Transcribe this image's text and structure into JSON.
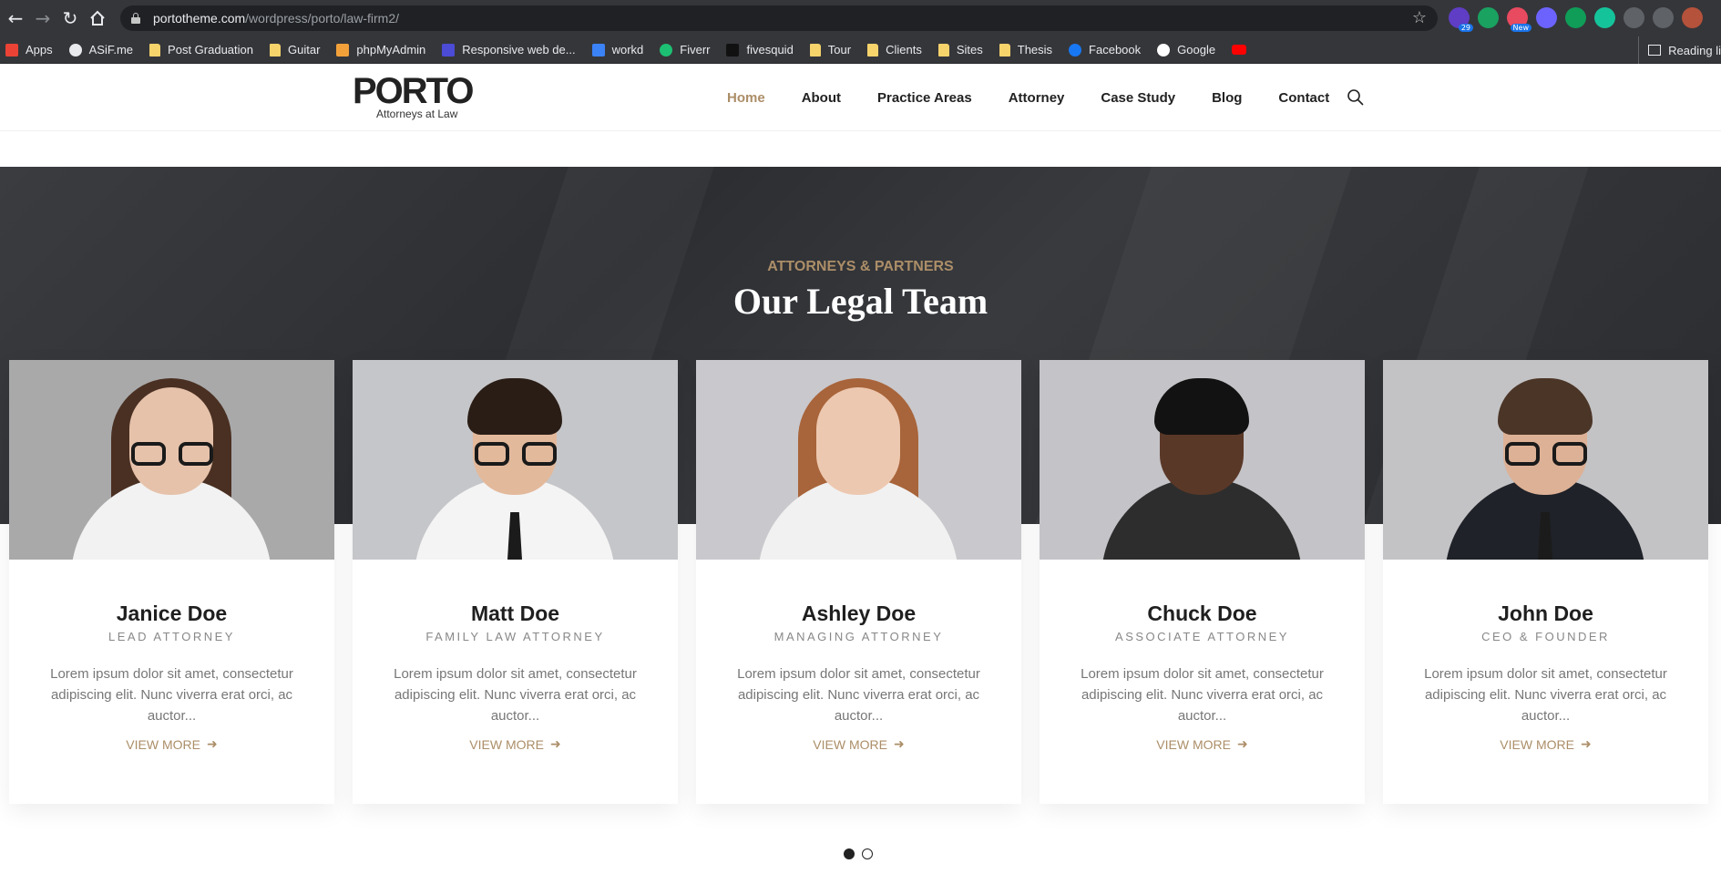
{
  "browser": {
    "url_host": "portotheme.com",
    "url_path": "/wordpress/porto/law-firm2/",
    "extensions": [
      {
        "name": "ext-29",
        "badge": "29",
        "color": "#5f3dc4"
      },
      {
        "name": "ext-refresh",
        "badge": "",
        "color": "#1aa260"
      },
      {
        "name": "ext-rainbow",
        "badge": "New",
        "color": "#e84a5f"
      },
      {
        "name": "ext-pen",
        "badge": "",
        "color": "#6c63ff"
      },
      {
        "name": "ext-leaf",
        "badge": "",
        "color": "#0f9d58"
      },
      {
        "name": "ext-grammarly",
        "badge": "",
        "color": "#15c39a"
      },
      {
        "name": "puzzle-icon",
        "badge": "",
        "color": "#5f6368"
      },
      {
        "name": "media-icon",
        "badge": "",
        "color": "#5f6368"
      },
      {
        "name": "profile-avatar",
        "badge": "",
        "color": "#b5523b"
      }
    ]
  },
  "bookmarks": [
    {
      "label": "Apps",
      "icon": "apps-grid",
      "color": "#ea4335"
    },
    {
      "label": "ASiF.me",
      "icon": "globe",
      "color": "#e8eaed"
    },
    {
      "label": "Post Graduation",
      "icon": "folder",
      "color": "#f6d36b"
    },
    {
      "label": "Guitar",
      "icon": "folder",
      "color": "#f6d36b"
    },
    {
      "label": "phpMyAdmin",
      "icon": "phpmyadmin",
      "color": "#f2a13a"
    },
    {
      "label": "Responsive web de...",
      "icon": "w-logo",
      "color": "#4b4bd6"
    },
    {
      "label": "workd",
      "icon": "check-logo",
      "color": "#3b82f6"
    },
    {
      "label": "Fiverr",
      "icon": "fiverr",
      "color": "#1dbf73"
    },
    {
      "label": "fivesquid",
      "icon": "f-logo",
      "color": "#111111"
    },
    {
      "label": "Tour",
      "icon": "folder",
      "color": "#f6d36b"
    },
    {
      "label": "Clients",
      "icon": "folder",
      "color": "#f6d36b"
    },
    {
      "label": "Sites",
      "icon": "folder",
      "color": "#f6d36b"
    },
    {
      "label": "Thesis",
      "icon": "folder",
      "color": "#f6d36b"
    },
    {
      "label": "Facebook",
      "icon": "facebook",
      "color": "#1877f2"
    },
    {
      "label": "Google",
      "icon": "google",
      "color": "#ffffff"
    },
    {
      "label": "",
      "icon": "youtube",
      "color": "#ff0000"
    }
  ],
  "reading_list_label": "Reading li",
  "site": {
    "logo": "PORTO",
    "tagline": "Attorneys at Law",
    "nav": [
      {
        "label": "Home",
        "active": true
      },
      {
        "label": "About",
        "active": false
      },
      {
        "label": "Practice Areas",
        "active": false
      },
      {
        "label": "Attorney",
        "active": false
      },
      {
        "label": "Case Study",
        "active": false
      },
      {
        "label": "Blog",
        "active": false
      },
      {
        "label": "Contact",
        "active": false
      }
    ],
    "accent_color": "#ac8e68"
  },
  "section": {
    "eyebrow": "ATTORNEYS & PARTNERS",
    "title": "Our Legal Team"
  },
  "team": [
    {
      "name": "Janice Doe",
      "role": "LEAD ATTORNEY",
      "desc": "Lorem ipsum dolor sit amet, consectetur adipiscing elit. Nunc viverra erat orci, ac auctor...",
      "cta": "VIEW MORE",
      "photo_bg": "#a9a9aa",
      "hair": "long-brown",
      "glasses": true
    },
    {
      "name": "Matt Doe",
      "role": "FAMILY LAW ATTORNEY",
      "desc": "Lorem ipsum dolor sit amet, consectetur adipiscing elit. Nunc viverra erat orci, ac auctor...",
      "cta": "VIEW MORE",
      "photo_bg": "#c5c6c9",
      "hair": "short-dark",
      "glasses": true
    },
    {
      "name": "Ashley Doe",
      "role": "MANAGING ATTORNEY",
      "desc": "Lorem ipsum dolor sit amet, consectetur adipiscing elit. Nunc viverra erat orci, ac auctor...",
      "cta": "VIEW MORE",
      "photo_bg": "#c9c8cc",
      "hair": "long-auburn",
      "glasses": false
    },
    {
      "name": "Chuck Doe",
      "role": "ASSOCIATE ATTORNEY",
      "desc": "Lorem ipsum dolor sit amet, consectetur adipiscing elit. Nunc viverra erat orci, ac auctor...",
      "cta": "VIEW MORE",
      "photo_bg": "#c4c3c7",
      "hair": "short-black",
      "glasses": false
    },
    {
      "name": "John Doe",
      "role": "CEO & FOUNDER",
      "desc": "Lorem ipsum dolor sit amet, consectetur adipiscing elit. Nunc viverra erat orci, ac auctor...",
      "cta": "VIEW MORE",
      "photo_bg": "#c3c3c5",
      "hair": "short-brown",
      "glasses": true
    }
  ],
  "carousel": {
    "pages": 2,
    "active": 0
  }
}
